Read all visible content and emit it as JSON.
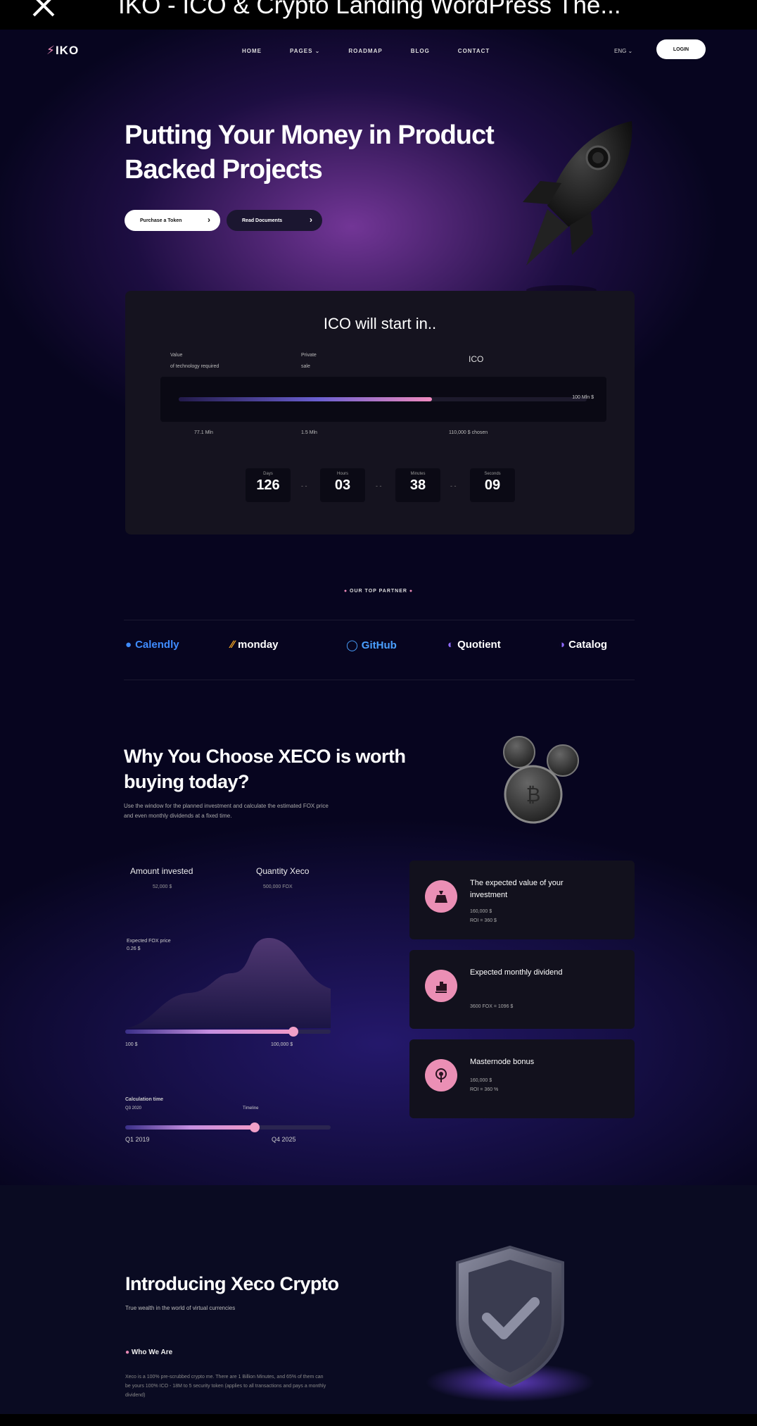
{
  "window": {
    "title": "IKO - ICO & Crypto Landing WordPress The..."
  },
  "nav": {
    "logo": "IKO",
    "items": [
      "HOME",
      "PAGES ⌄",
      "ROADMAP",
      "BLOG",
      "CONTACT"
    ],
    "lang": "ENG ⌄",
    "login": "LOGIN"
  },
  "hero": {
    "heading": "Putting Your Money in Product Backed Projects",
    "btn_primary": "Purchase a Token",
    "btn_secondary": "Read Documents"
  },
  "ico": {
    "title": "ICO will start in..",
    "label_value": "Value\nof technology required",
    "label_private": "Private\nsale",
    "label_ico": "ICO",
    "progress_pct": 62,
    "max_label": "100 Mln $",
    "bottom": [
      "77.1 Mln",
      "1.5 Mln",
      "110,000 $ chosen"
    ],
    "countdown": [
      {
        "unit": "Days",
        "value": "126"
      },
      {
        "unit": "Hours",
        "value": "03"
      },
      {
        "unit": "Minutes",
        "value": "38"
      },
      {
        "unit": "Seconds",
        "value": "09"
      }
    ],
    "separator": "- -"
  },
  "partners": {
    "label": "OUR TOP PARTNER",
    "items": [
      {
        "name": "Calendly",
        "color": "#3f8cff"
      },
      {
        "name": "monday",
        "color": "#ffffff"
      },
      {
        "name": "GitHub",
        "color": "#4aa0ff"
      },
      {
        "name": "Quotient",
        "color": "#ffffff"
      },
      {
        "name": "Catalog",
        "color": "#ffffff"
      }
    ]
  },
  "why": {
    "heading": "Why You Choose XECO is worth buying today?",
    "desc": "Use the window for the planned investment and calculate the estimated FOX price and even monthly dividends at a fixed time.",
    "calc": {
      "amount_label": "Amount invested",
      "amount_value": "52,000 $",
      "qty_label": "Quantity Xeco",
      "qty_value": "500,000 FOX",
      "price_label": "Expected FOX price",
      "price_value": "0.26 $",
      "range_min": "100 $",
      "range_max": "100,000 $",
      "range_pct": 0.82,
      "cal_label": "Calculation time",
      "cal_start": "Q3 2020",
      "cal_tl": "Timeline",
      "cal_from": "Q1 2019",
      "cal_to": "Q4 2025",
      "cal_pct": 0.63
    },
    "features": [
      {
        "title": "The expected value of your investment",
        "lines": [
          "160,000 $",
          "ROI = 360 $"
        ],
        "icon": "money-bag-icon"
      },
      {
        "title": "Expected monthly dividend",
        "lines": [
          "3600 FOX = 1096 $"
        ],
        "icon": "bar-chart-icon"
      },
      {
        "title": "Masternode bonus",
        "lines": [
          "160,000 $",
          "ROI = 360 %"
        ],
        "icon": "broadcast-icon"
      }
    ]
  },
  "intro": {
    "heading": "Introducing Xeco Crypto",
    "desc": "True wealth in the world of virtual currencies",
    "who": "Who We Are",
    "para": "Xeco is a 100% pre-scrubbed crypto me. There are 1 Billion Minutes, and 65% of them can be yours 100% ICO - 18M to 5 security token (applies to all transactions and pays a monthly dividend)"
  }
}
